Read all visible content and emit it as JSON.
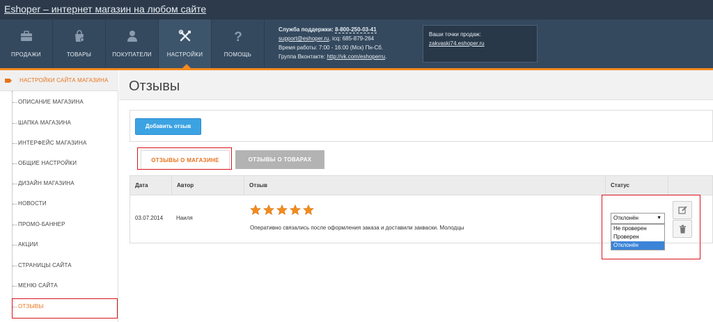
{
  "header": {
    "site_title": "Eshoper – интернет магазин на любом сайте"
  },
  "nav": {
    "items": [
      {
        "label": "Продажи",
        "icon": "sales-briefcase-icon"
      },
      {
        "label": "Товары",
        "icon": "products-bag-icon"
      },
      {
        "label": "Покупатели",
        "icon": "customer-person-icon"
      },
      {
        "label": "Настройки",
        "icon": "settings-tools-icon",
        "active": true
      },
      {
        "label": "Помощь",
        "icon": "help-question-icon"
      }
    ]
  },
  "support": {
    "title": "Служба поддержки:",
    "phone": "8-800-250-03-41",
    "email": "support@eshoper.ru",
    "icq": ", icq: 685-879-264",
    "hours": "Время работы: 7:00 - 16:00 (Мск) Пн-Сб.",
    "vk_label": "Группа Вконтакте:",
    "vk_link": "http://vk.com/eshoperru",
    "vk_suffix": "."
  },
  "points": {
    "title": "Ваши точки продаж:",
    "link": "zakvaski74.eshoper.ru"
  },
  "sidebar": {
    "title": "Настройки сайта магазина",
    "items": [
      {
        "label": "Описание магазина"
      },
      {
        "label": "Шапка магазина"
      },
      {
        "label": "Интерфейс магазина"
      },
      {
        "label": "Общие настройки"
      },
      {
        "label": "Дизайн магазина"
      },
      {
        "label": "Новости"
      },
      {
        "label": "Промо-баннер"
      },
      {
        "label": "Акции"
      },
      {
        "label": "Страницы сайта"
      },
      {
        "label": "Меню сайта"
      },
      {
        "label": "Отзывы",
        "active": true
      }
    ]
  },
  "main": {
    "page_title": "Отзывы",
    "add_button": "Добавить отзыв",
    "tabs": [
      {
        "label": "Отзывы о магазине",
        "active": true
      },
      {
        "label": "Отзывы о товарах",
        "active": false
      }
    ],
    "table": {
      "columns": [
        "Дата",
        "Автор",
        "Отзыв",
        "Статус"
      ],
      "rows": [
        {
          "date": "03.07.2014",
          "author": "Наиля",
          "rating": 5,
          "text": "Оперативно связались после оформления заказа и доставили закваски. Молодцы",
          "status": {
            "selected": "Отклонён",
            "options": [
              "Не проверен",
              "Проверен",
              "Отклонён"
            ],
            "highlighted": "Отклонён"
          }
        }
      ]
    }
  },
  "colors": {
    "accent": "#f48a1e",
    "nav_bg": "#34495e",
    "button_blue": "#3ca3e2",
    "highlight_red": "#d9131a",
    "star": "#f28c1a"
  }
}
